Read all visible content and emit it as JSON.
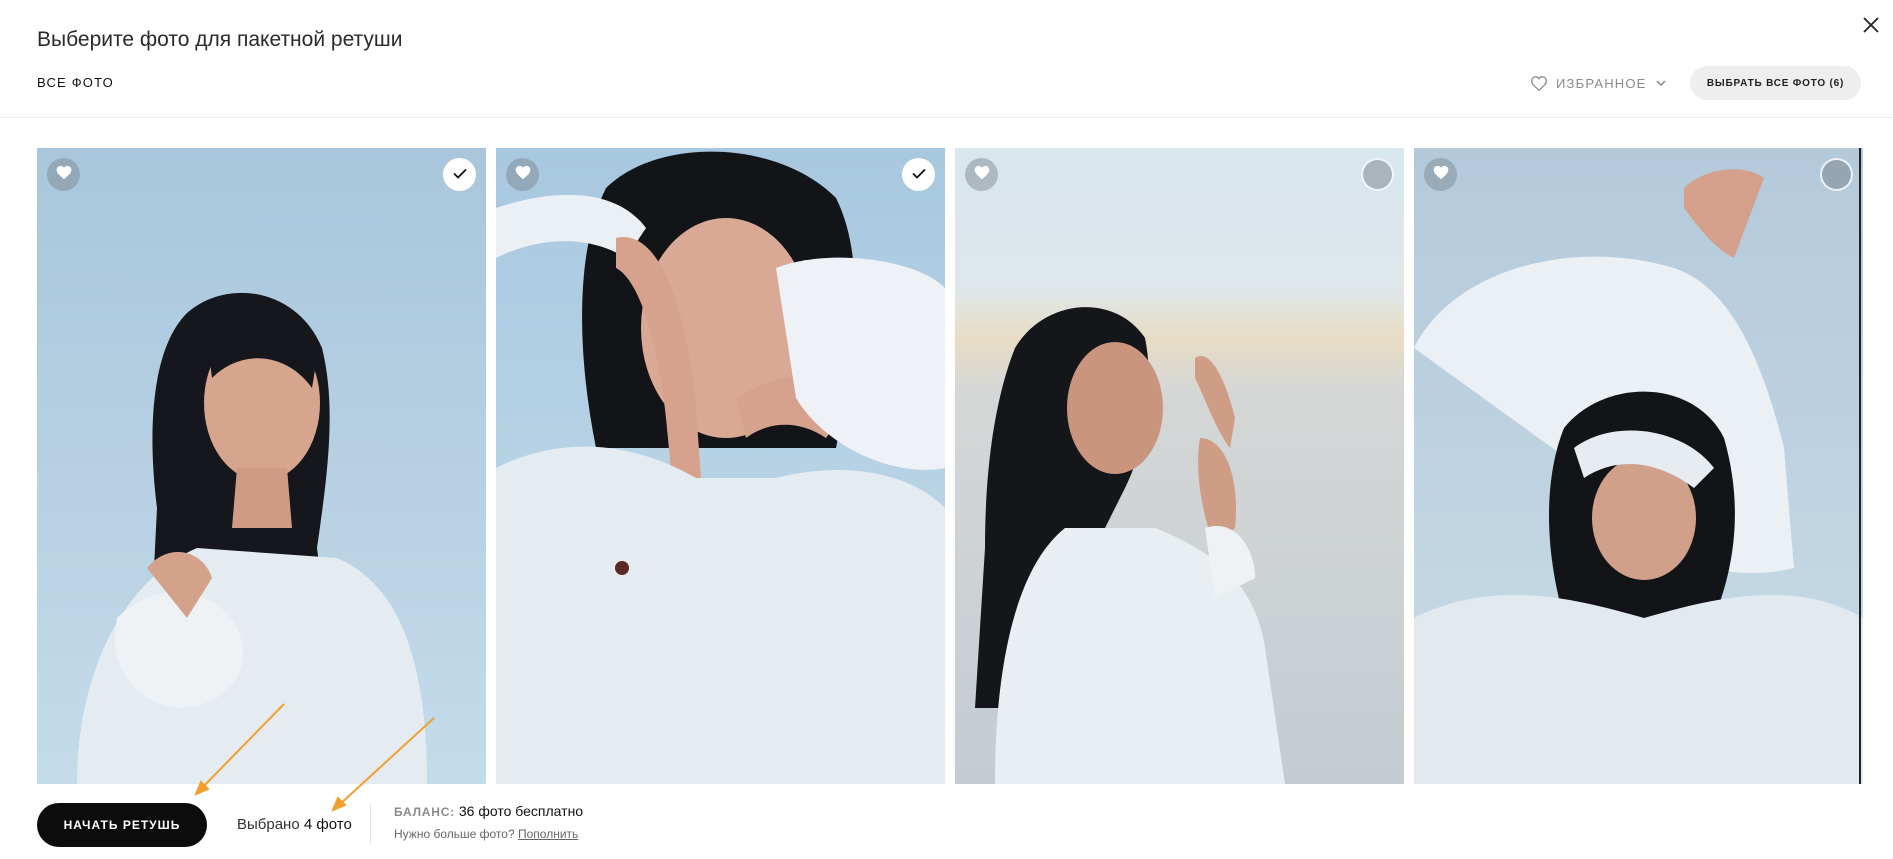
{
  "header": {
    "title": "Выберите фото для пакетной ретуши",
    "tab_all": "ВСЕ ФОТО",
    "favorites_filter": "ИЗБРАННОЕ",
    "select_all_button": "ВЫБРАТЬ ВСЕ ФОТО (6)"
  },
  "photos": [
    {
      "selected": true
    },
    {
      "selected": true
    },
    {
      "selected": false
    },
    {
      "selected": false
    }
  ],
  "footer": {
    "start_button": "НАЧАТЬ РЕТУШЬ",
    "selected_prefix": "Выбрано",
    "selected_count": "4 фото",
    "balance_label": "БАЛАНС:",
    "balance_value": "36 фото бесплатно",
    "need_more": "Нужно больше фото?",
    "top_up_link": "Пополнить"
  },
  "colors": {
    "accent_arrow": "#f0a030",
    "primary_button": "#0c0c0c"
  },
  "icons": [
    "close-icon",
    "heart-icon",
    "chevron-down-icon",
    "checkmark-icon"
  ]
}
